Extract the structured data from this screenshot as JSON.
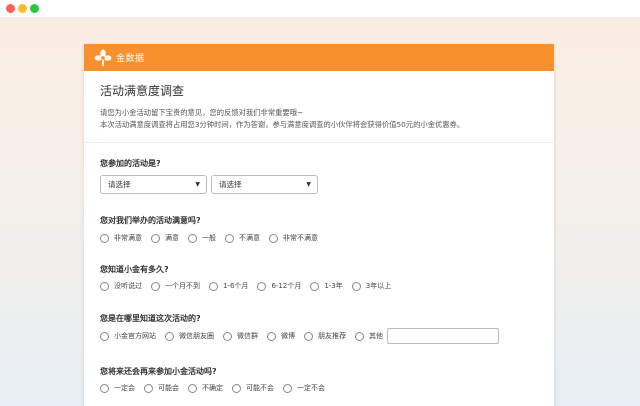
{
  "brand": {
    "name": "金数据",
    "color": "#f7902d"
  },
  "survey": {
    "title": "活动满意度调查",
    "intro_line1": "请您为小金活动留下宝贵的意见，您的反馈对我们非常重要哦~",
    "intro_line2": "本次活动满意度调查将占用您3分钟时间，作为答谢，参与满意度调查的小伙伴将会获得价值50元的小金优惠券。"
  },
  "q1": {
    "label": "您参加的活动是?",
    "select1": "请选择",
    "select2": "请选择"
  },
  "q2": {
    "label": "您对我们举办的活动满意吗?",
    "options": [
      "非常满意",
      "满意",
      "一般",
      "不满意",
      "非常不满意"
    ]
  },
  "q3": {
    "label": "您知道小金有多久?",
    "options": [
      "没听说过",
      "一个月不到",
      "1-6个月",
      "6-12个月",
      "1-3年",
      "3年以上"
    ]
  },
  "q4": {
    "label": "您是在哪里知道这次活动的?",
    "options": [
      "小金官方网站",
      "微信朋友圈",
      "微信群",
      "微博",
      "朋友推荐",
      "其他"
    ]
  },
  "q5": {
    "label": "您将来还会再来参加小金活动吗?",
    "options": [
      "一定会",
      "可能会",
      "不确定",
      "可能不会",
      "一定不会"
    ]
  }
}
